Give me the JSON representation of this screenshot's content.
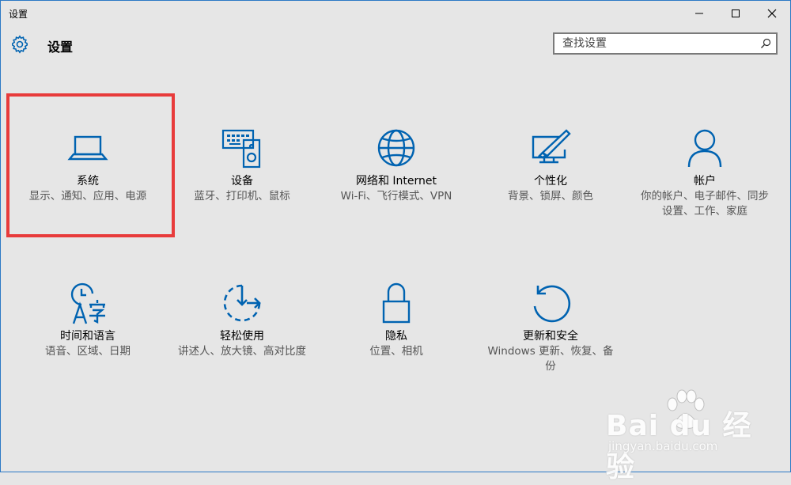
{
  "window": {
    "title": "设置",
    "accent_color": "#0063b1",
    "highlight_color": "#e83b3b"
  },
  "header": {
    "title": "设置",
    "icon": "gear-icon"
  },
  "search": {
    "placeholder": "查找设置",
    "icon": "search-icon"
  },
  "tiles": [
    {
      "name": "系统",
      "desc": "显示、通知、应用、电源",
      "icon": "laptop-icon"
    },
    {
      "name": "设备",
      "desc": "蓝牙、打印机、鼠标",
      "icon": "devices-icon"
    },
    {
      "name": "网络和 Internet",
      "desc": "Wi-Fi、飞行模式、VPN",
      "icon": "globe-icon"
    },
    {
      "name": "个性化",
      "desc": "背景、锁屏、颜色",
      "icon": "personalization-icon"
    },
    {
      "name": "帐户",
      "desc": "你的帐户、电子邮件、同步设置、工作、家庭",
      "icon": "person-icon"
    },
    {
      "name": "时间和语言",
      "desc": "语音、区域、日期",
      "icon": "time-language-icon"
    },
    {
      "name": "轻松使用",
      "desc": "讲述人、放大镜、高对比度",
      "icon": "ease-of-access-icon"
    },
    {
      "name": "隐私",
      "desc": "位置、相机",
      "icon": "lock-icon"
    },
    {
      "name": "更新和安全",
      "desc": "Windows 更新、恢复、备份",
      "icon": "update-icon"
    }
  ],
  "watermark": {
    "brand": "Bai du 经验",
    "url": "jingyan.baidu.com"
  }
}
